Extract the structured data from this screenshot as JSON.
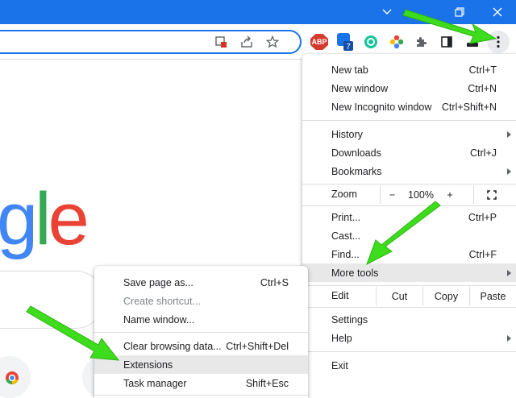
{
  "toolbar": {
    "abp_label": "ABP",
    "badge_count": "7"
  },
  "background": {
    "logo_letters": [
      "g",
      "l",
      "e"
    ]
  },
  "main_menu": {
    "items": {
      "new_tab": {
        "label": "New tab",
        "shortcut": "Ctrl+T"
      },
      "new_window": {
        "label": "New window",
        "shortcut": "Ctrl+N"
      },
      "new_incognito": {
        "label": "New Incognito window",
        "shortcut": "Ctrl+Shift+N"
      },
      "history": {
        "label": "History"
      },
      "downloads": {
        "label": "Downloads",
        "shortcut": "Ctrl+J"
      },
      "bookmarks": {
        "label": "Bookmarks"
      },
      "print": {
        "label": "Print...",
        "shortcut": "Ctrl+P"
      },
      "cast": {
        "label": "Cast..."
      },
      "find": {
        "label": "Find...",
        "shortcut": "Ctrl+F"
      },
      "more_tools": {
        "label": "More tools"
      },
      "settings": {
        "label": "Settings"
      },
      "help": {
        "label": "Help"
      },
      "exit": {
        "label": "Exit"
      }
    },
    "zoom": {
      "label": "Zoom",
      "minus": "−",
      "value": "100%",
      "plus": "+"
    },
    "edit": {
      "label": "Edit",
      "cut": "Cut",
      "copy": "Copy",
      "paste": "Paste"
    }
  },
  "sub_menu": {
    "items": {
      "save_page": {
        "label": "Save page as...",
        "shortcut": "Ctrl+S"
      },
      "create_shortcut": {
        "label": "Create shortcut..."
      },
      "name_window": {
        "label": "Name window..."
      },
      "clear_browsing": {
        "label": "Clear browsing data...",
        "shortcut": "Ctrl+Shift+Del"
      },
      "extensions": {
        "label": "Extensions"
      },
      "task_manager": {
        "label": "Task manager",
        "shortcut": "Shift+Esc"
      }
    }
  },
  "colors": {
    "titlebar": "#1a73e8",
    "highlight": "#e8e8e9",
    "annotation_arrow": "#3ddc1c"
  }
}
